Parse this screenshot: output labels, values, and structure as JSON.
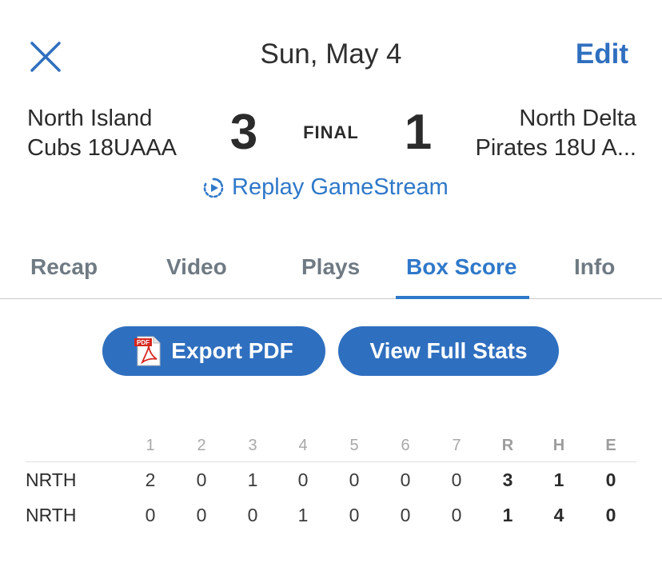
{
  "header": {
    "title": "Sun, May 4",
    "edit_label": "Edit",
    "close_icon": "close-icon"
  },
  "game": {
    "away_team_line1": "North Island",
    "away_team_line2": "Cubs 18UAAA",
    "home_team_line1": "North Delta",
    "home_team_line2": "Pirates 18U A...",
    "away_score": "3",
    "home_score": "1",
    "status": "FINAL"
  },
  "replay": {
    "label": "Replay GameStream",
    "icon": "replay-icon"
  },
  "tabs": [
    {
      "label": "Recap",
      "active": false
    },
    {
      "label": "Video",
      "active": false
    },
    {
      "label": "Plays",
      "active": false
    },
    {
      "label": "Box Score",
      "active": true
    },
    {
      "label": "Info",
      "active": false
    }
  ],
  "actions": {
    "export_label": "Export PDF",
    "export_icon": "pdf-icon",
    "pdf_badge": "PDF",
    "stats_label": "View Full Stats"
  },
  "box_score": {
    "headers": [
      "1",
      "2",
      "3",
      "4",
      "5",
      "6",
      "7",
      "R",
      "H",
      "E"
    ],
    "rows": [
      {
        "team": "NRTH",
        "values": [
          "2",
          "0",
          "1",
          "0",
          "0",
          "0",
          "0",
          "3",
          "1",
          "0"
        ]
      },
      {
        "team": "NRTH",
        "values": [
          "0",
          "0",
          "0",
          "1",
          "0",
          "0",
          "0",
          "1",
          "4",
          "0"
        ]
      }
    ]
  },
  "colors": {
    "accent": "#2f78c9",
    "button": "#2f6fbf",
    "text": "#2b2b2b",
    "muted": "#6f7a83"
  }
}
